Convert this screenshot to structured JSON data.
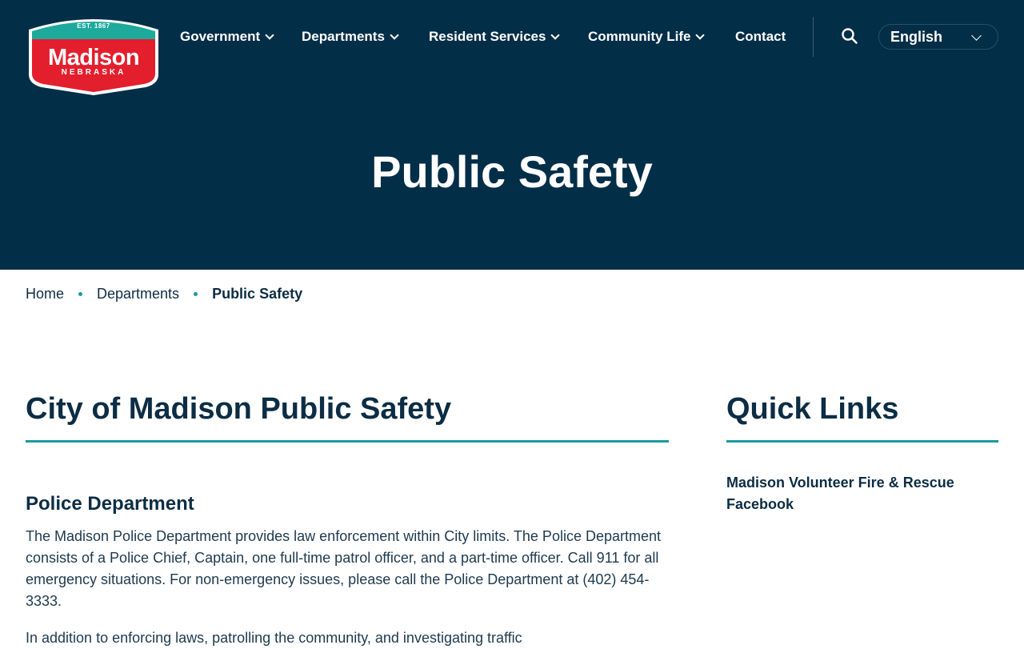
{
  "logo": {
    "est": "EST. 1867",
    "name": "Madison",
    "state": "NEBRASKA"
  },
  "nav": {
    "items": [
      {
        "label": "Government",
        "has_dropdown": true
      },
      {
        "label": "Departments",
        "has_dropdown": true
      },
      {
        "label": "Resident Services",
        "has_dropdown": true
      },
      {
        "label": "Community Life",
        "has_dropdown": true
      },
      {
        "label": "Contact",
        "has_dropdown": false
      }
    ],
    "search_icon": "search-icon",
    "language": "English"
  },
  "hero": {
    "title": "Public Safety"
  },
  "breadcrumb": {
    "items": [
      "Home",
      "Departments"
    ],
    "current": "Public Safety"
  },
  "main": {
    "heading": "City of Madison Public Safety",
    "section_heading": "Police Department",
    "paragraph_1": "The Madison Police Department provides law enforcement within City limits. The Police Department consists of a Police Chief, Captain, one full-time patrol officer, and a part-time officer. Call 911 for all emergency situations. For non-emergency issues, please call the Police Department at (402) 454-3333.",
    "paragraph_2_visible": "In addition to enforcing laws, patrolling the community, and investigating traffic"
  },
  "sidebar": {
    "heading": "Quick Links",
    "links": [
      "Madison Volunteer Fire & Rescue Facebook"
    ]
  },
  "colors": {
    "header_bg": "#032e48",
    "accent_teal": "#1a9aa0",
    "logo_red": "#e31e2d",
    "logo_teal": "#1ea99d",
    "text_dark": "#0c2d44"
  }
}
